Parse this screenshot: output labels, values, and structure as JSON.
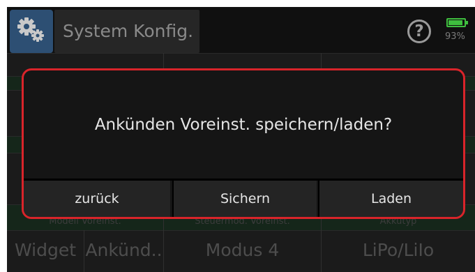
{
  "header": {
    "title": "System Konfig.",
    "app_icon": "gears-icon",
    "help_symbol": "?",
    "battery_percent": "93%",
    "battery_level": 0.93,
    "battery_color": "#3fbf3f"
  },
  "background": {
    "labels": [
      "Modell Voreinst.",
      "Steuermod. Voreinst.",
      "Akkutyp"
    ],
    "values": [
      "Widget",
      "Ankünd..",
      "Modus 4",
      "LiPo/LiIo"
    ]
  },
  "dialog": {
    "message": "Ankünden Voreinst. speichern/laden?",
    "border_color": "#d9242a",
    "buttons": [
      "zurück",
      "Sichern",
      "Laden"
    ]
  }
}
